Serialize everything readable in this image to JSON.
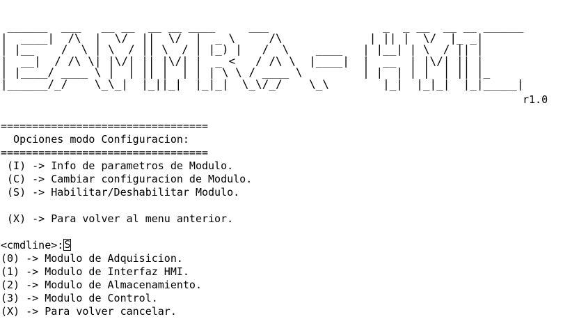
{
  "banner": {
    "ascii_art": " ______  ___   __ __  __ __ ____     ___                 _  _ __  __ __ ______\n|  ____|  /\\  |  \\/  ||  \\/  |  _ \\     /\\             | || |  \\/  |_ _|\n| |__    /  \\ | \\  / || \\  / | |_) |   /  \\    ____   | |__| | \\  / || | \n|  __|  / /\\ \\| |\\/| || |\\/| |  _ <   / /\\ \\  |____|  |  __  | |\\/| || | \n| |____/ ____ \\ |  | || |  | | | \\ \\ / ____ \\         | |  | | |  | || |_\n|______/_/    \\_\\_|  |_||_|  |_|_|  \\_\\/_/    \\_\\        |_|  |_|_|  |_|_____|",
    "version": "r1.0"
  },
  "terminal": {
    "lines": [
      "=================================",
      "  Opciones modo Configuracion:",
      "=================================",
      " (I) -> Info de parametros de Modulo.",
      " (C) -> Cambiar configuracion de Modulo.",
      " (S) -> Habilitar/Deshabilitar Modulo.",
      "",
      " (X) -> Para volver al menu anterior.",
      ""
    ],
    "prompt": "<cmdline>:",
    "input_value": "S",
    "module_options": [
      "(0) -> Modulo de Adquisicion.",
      "(1) -> Modulo de Interfaz HMI.",
      "(2) -> Modulo de Almacenamiento.",
      "(3) -> Modulo de Control.",
      "(X) -> Para volver cancelar."
    ]
  }
}
